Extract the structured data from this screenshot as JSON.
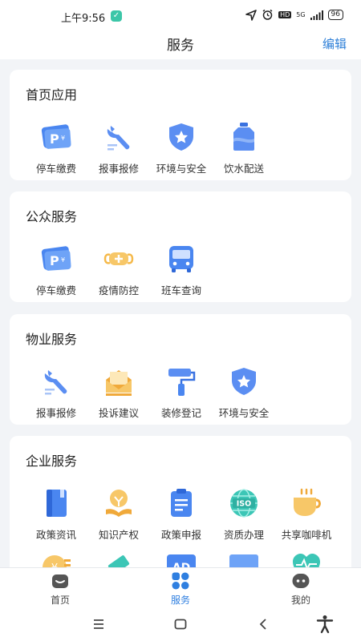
{
  "status_bar": {
    "time": "上午9:56",
    "network": "5G",
    "battery": "96",
    "hd": "HD"
  },
  "header": {
    "title": "服务",
    "edit_label": "编辑"
  },
  "sections": [
    {
      "title": "首页应用",
      "items": [
        {
          "label": "停车缴费",
          "icon": "parking-icon"
        },
        {
          "label": "报事报修",
          "icon": "wrench-icon"
        },
        {
          "label": "环境与安全",
          "icon": "shield-star-icon"
        },
        {
          "label": "饮水配送",
          "icon": "water-bottle-icon"
        }
      ]
    },
    {
      "title": "公众服务",
      "items": [
        {
          "label": "停车缴费",
          "icon": "parking-icon"
        },
        {
          "label": "疫情防控",
          "icon": "mask-icon"
        },
        {
          "label": "班车查询",
          "icon": "bus-icon"
        }
      ]
    },
    {
      "title": "物业服务",
      "items": [
        {
          "label": "报事报修",
          "icon": "wrench-icon"
        },
        {
          "label": "投诉建议",
          "icon": "envelope-icon"
        },
        {
          "label": "装修登记",
          "icon": "paint-roller-icon"
        },
        {
          "label": "环境与安全",
          "icon": "shield-star-icon"
        }
      ]
    },
    {
      "title": "企业服务",
      "items": [
        {
          "label": "政策资讯",
          "icon": "book-icon"
        },
        {
          "label": "知识产权",
          "icon": "lightbulb-icon"
        },
        {
          "label": "政策申报",
          "icon": "clipboard-icon"
        },
        {
          "label": "资质办理",
          "icon": "iso-globe-icon"
        },
        {
          "label": "共享咖啡机",
          "icon": "coffee-icon"
        }
      ]
    }
  ],
  "partial_row_icons": [
    "coin-icon",
    "ticket-icon",
    "ad-icon",
    "screen-icon",
    "health-icon"
  ],
  "iso_text": "ISO",
  "ad_text": "AD",
  "tabs": [
    {
      "label": "首页",
      "icon": "home-icon",
      "active": false
    },
    {
      "label": "服务",
      "icon": "grid-icon",
      "active": true
    },
    {
      "label": "我的",
      "icon": "chat-face-icon",
      "active": false
    }
  ],
  "colors": {
    "accent": "#2f7fe0",
    "blue_icon": "#4a86f0",
    "orange_icon": "#f5b94a",
    "background": "#f2f4f7"
  }
}
